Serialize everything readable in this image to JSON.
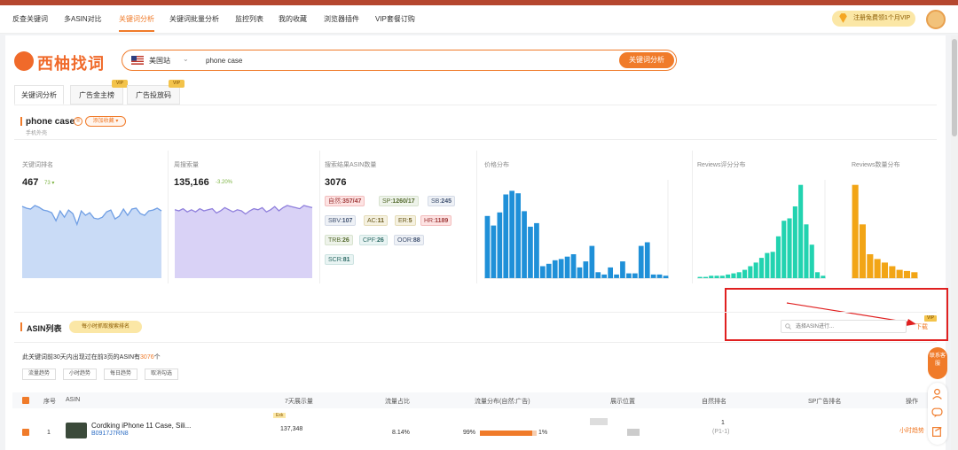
{
  "nav": {
    "items": [
      "反查关键词",
      "多ASIN对比",
      "关键词分析",
      "关键词批量分析",
      "监控列表",
      "我的收藏",
      "浏览器插件",
      "VIP套餐订购"
    ],
    "active": "关键词分析",
    "vip_promo": "注册免费领1个月VIP"
  },
  "logo": {
    "text": "西柚找词"
  },
  "search": {
    "site": "美国站",
    "query": "phone case",
    "button": "关键词分析"
  },
  "tabs": [
    {
      "label": "关键词分析",
      "vip": false
    },
    {
      "label": "广告金主榜",
      "vip": true
    },
    {
      "label": "广告投放码",
      "vip": true
    }
  ],
  "vip_label": "VIP",
  "keyword": {
    "title": "phone case",
    "favorite_button": "添加收藏 ▾",
    "subtitle": "手机外壳"
  },
  "stats": {
    "rank": {
      "label": "关键词排名",
      "value": "467",
      "delta": "73 ▾"
    },
    "search_volume": {
      "label": "周搜索量",
      "value": "135,166",
      "delta": "-3.20%"
    },
    "asin_count": {
      "label": "搜索结果ASIN数量",
      "value": "3076"
    },
    "price_label": "价格分布",
    "reviews_rating_label": "Reviews评分分布",
    "reviews_count_label": "Reviews数量分布"
  },
  "asin_chips": [
    {
      "k": "自然:",
      "v": "357/47",
      "style": "r"
    },
    {
      "k": "SP:",
      "v": "1260/17",
      "style": "g"
    },
    {
      "k": "SB:",
      "v": "245",
      "style": "b"
    },
    {
      "k": "SBV:",
      "v": "107",
      "style": "b"
    },
    {
      "k": "AC:",
      "v": "11",
      "style": "y"
    },
    {
      "k": "ER:",
      "v": "5",
      "style": "y"
    },
    {
      "k": "HR:",
      "v": "1189",
      "style": "r"
    },
    {
      "k": "TRB:",
      "v": "26",
      "style": "g"
    },
    {
      "k": "CPF:",
      "v": "26",
      "style": "c"
    },
    {
      "k": "OOR:",
      "v": "88",
      "style": "b"
    },
    {
      "k": "SCR:",
      "v": "81",
      "style": "c"
    }
  ],
  "download": {
    "placeholder": "选择ASIN进行...",
    "button": "下载"
  },
  "asin_section": {
    "title": "ASIN列表",
    "badge": "每小时抓取搜索排名",
    "desc_pre": "此关键词前30天内出现过在前3页的ASIN有",
    "desc_num": "3076",
    "desc_post": "个",
    "buttons": [
      "流量趋势",
      "小时趋势",
      "每日趋势",
      "取消勾选"
    ]
  },
  "table": {
    "headers": [
      "序号",
      "ASIN",
      "7天展示量",
      "流量占比",
      "流量分布(自然:广告)",
      "展示位置",
      "自然排名",
      "SP广告排名",
      "操作"
    ],
    "rows": [
      {
        "index": "1",
        "title": "Cordking iPhone 11 Case, Sili...",
        "asin": "B0917J7RN8",
        "badge": "Exk",
        "impressions": "137,348",
        "share": "8.14%",
        "dist_left": "99%",
        "dist_right": "1%",
        "natural_rank": "1",
        "natural_rank_sub": "(P1-1)",
        "action": "小时趋势"
      }
    ]
  },
  "float": {
    "label": "联系客服"
  },
  "chart_data": [
    {
      "type": "area",
      "title": "关键词排名",
      "values": [
        1200,
        1180,
        1170,
        1210,
        1190,
        1160,
        1150,
        1130,
        1040,
        1150,
        1080,
        1160,
        1120,
        1000,
        1150,
        1100,
        1130,
        1070,
        1060,
        1080,
        1140,
        1160,
        1060,
        1090,
        1170,
        1100,
        1170,
        1180,
        1120,
        1100,
        1150,
        1160,
        1180,
        1150
      ]
    },
    {
      "type": "area",
      "title": "周搜索量",
      "values": [
        1120,
        1110,
        1130,
        1100,
        1120,
        1100,
        1130,
        1110,
        1120,
        1130,
        1090,
        1110,
        1140,
        1120,
        1100,
        1120,
        1110,
        1080,
        1110,
        1130,
        1120,
        1140,
        1100,
        1120,
        1150,
        1110,
        1140,
        1160,
        1150,
        1140,
        1130,
        1160,
        1150,
        1140
      ]
    },
    {
      "type": "bar",
      "title": "价格分布",
      "values": [
        52,
        44,
        55,
        70,
        73,
        71,
        56,
        43,
        46,
        10,
        12,
        15,
        16,
        18,
        20,
        9,
        14,
        27,
        5,
        3,
        9,
        3,
        14,
        4,
        4,
        27,
        30,
        3,
        3,
        2
      ],
      "ylim": [
        0,
        80
      ]
    },
    {
      "type": "bar",
      "title": "Reviews评分分布",
      "values": [
        1,
        1,
        2,
        2,
        2,
        3,
        4,
        5,
        7,
        10,
        13,
        17,
        21,
        22,
        35,
        48,
        50,
        60,
        78,
        45,
        28,
        5,
        2
      ],
      "ylim": [
        0,
        80
      ]
    },
    {
      "type": "bar",
      "title": "Reviews数量分布",
      "values": [
        78,
        45,
        20,
        16,
        13,
        10,
        7,
        6,
        5
      ],
      "ylim": [
        0,
        80
      ]
    }
  ]
}
